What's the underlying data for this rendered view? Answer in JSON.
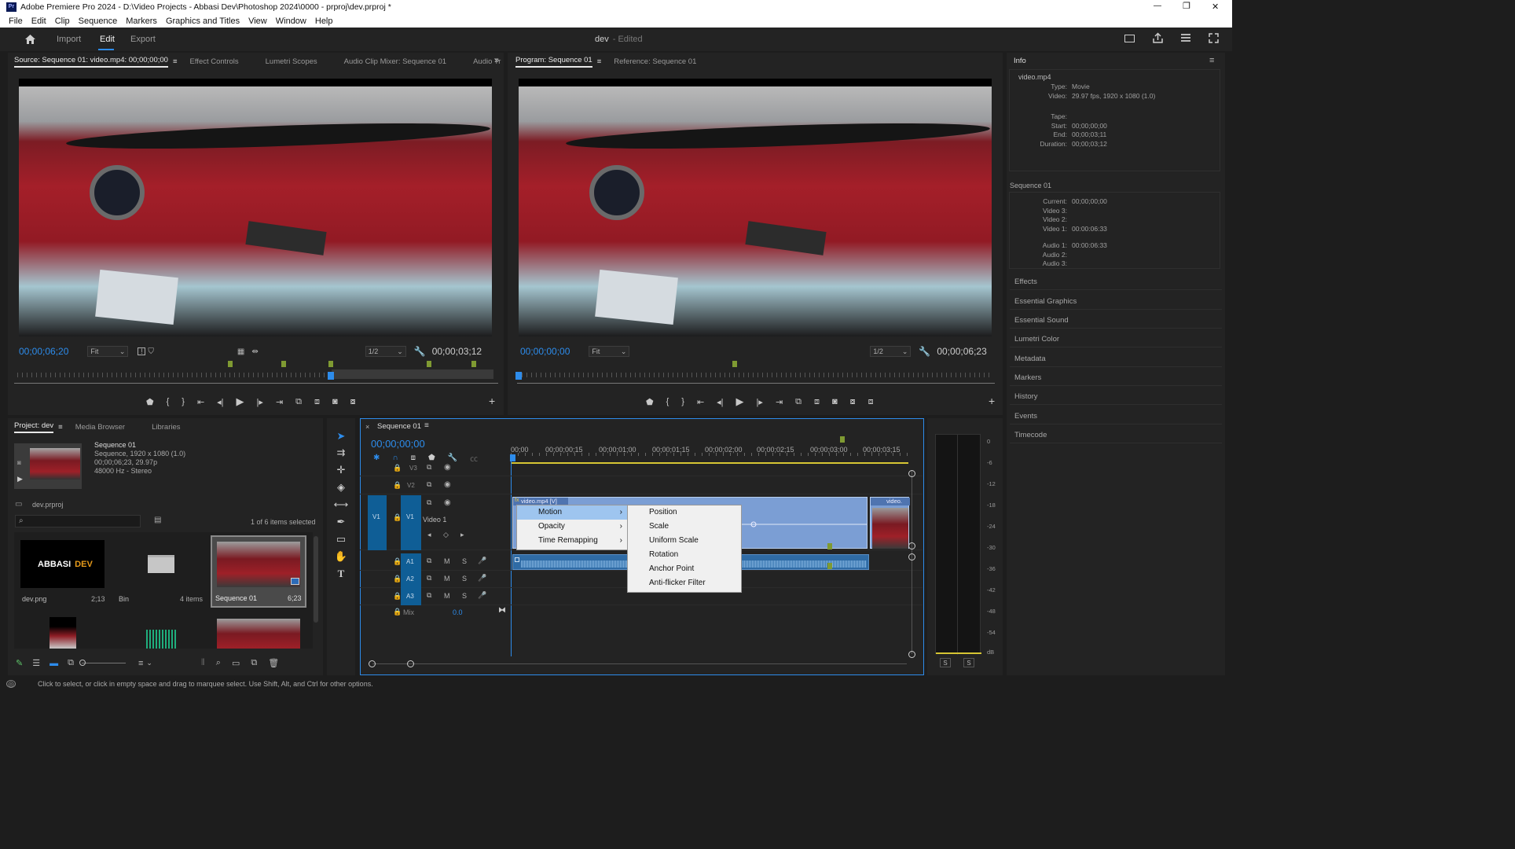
{
  "app": {
    "title": "Adobe Premiere Pro 2024 - D:\\Video Projects - Abbasi Dev\\Photoshop 2024\\0000 - prproj\\dev.prproj *",
    "logo": "Pr"
  },
  "window_buttons": {
    "minimize": "—",
    "maximize": "❐",
    "close": "✕"
  },
  "menu": [
    "File",
    "Edit",
    "Clip",
    "Sequence",
    "Markers",
    "Graphics and Titles",
    "View",
    "Window",
    "Help"
  ],
  "workspace": {
    "tabs": [
      "Import",
      "Edit",
      "Export"
    ],
    "active": "Edit",
    "project": "dev",
    "edited": "- Edited"
  },
  "source": {
    "tabs": [
      "Source: Sequence 01: video.mp4: 00;00;00;00",
      "Effect Controls",
      "Lumetri Scopes",
      "Audio Clip Mixer: Sequence 01",
      "Audio Tr"
    ],
    "timecode": "00;00;06;20",
    "fit": "Fit",
    "res": "1/2",
    "duration": "00;00;03;12",
    "overflow": "»"
  },
  "program": {
    "tabs": [
      "Program: Sequence 01",
      "Reference: Sequence 01"
    ],
    "timecode": "00;00;00;00",
    "fit": "Fit",
    "res": "1/2",
    "duration": "00;00;06;23"
  },
  "info": {
    "title": "Info",
    "clip_name": "video.mp4",
    "clip": [
      {
        "k": "Type:",
        "v": "Movie"
      },
      {
        "k": "Video:",
        "v": "29.97 fps, 1920 x 1080 (1.0)"
      }
    ],
    "tape": [
      {
        "k": "Tape:",
        "v": ""
      },
      {
        "k": "Start:",
        "v": "00;00;00;00"
      },
      {
        "k": "End:",
        "v": "00;00;03;11"
      },
      {
        "k": "Duration:",
        "v": "00;00;03;12"
      }
    ],
    "sequence_label": "Sequence 01",
    "seq": [
      {
        "k": "Current:",
        "v": "00;00;00;00"
      },
      {
        "k": "Video 3:",
        "v": ""
      },
      {
        "k": "Video 2:",
        "v": ""
      },
      {
        "k": "Video 1:",
        "v": "00:00:06:33"
      }
    ],
    "audio": [
      {
        "k": "Audio 1:",
        "v": "00:00:06:33"
      },
      {
        "k": "Audio 2:",
        "v": ""
      },
      {
        "k": "Audio 3:",
        "v": ""
      }
    ]
  },
  "right_sections": [
    "Effects",
    "Essential Graphics",
    "Essential Sound",
    "Lumetri Color",
    "Metadata",
    "Markers",
    "History",
    "Events",
    "Timecode"
  ],
  "project": {
    "tabs": [
      "Project: dev",
      "Media Browser",
      "Libraries"
    ],
    "seq_name": "Sequence 01",
    "seq_details": [
      "Sequence, 1920 x 1080 (1.0)",
      "00;00;06;23, 29.97p",
      "48000 Hz - Stereo"
    ],
    "file": "dev.prproj",
    "selected": "1 of 6 items selected",
    "items": [
      {
        "name": "dev.png",
        "meta": "2;13",
        "thumb": "ABBASI"
      },
      {
        "name": "Bin",
        "meta": "4 items"
      },
      {
        "name": "Sequence 01",
        "meta": "6;23"
      }
    ],
    "logo_word1": "ABBASI",
    "logo_word2": "DEV"
  },
  "timeline": {
    "tab": "Sequence 01",
    "timecode": "00;00;00;00",
    "ruler": [
      "00;00",
      "00;00;00;15",
      "00;00;01;00",
      "00;00;01;15",
      "00;00;02;00",
      "00;00;02;15",
      "00;00;03;00",
      "00;00;03;15"
    ],
    "video_tracks": [
      "V3",
      "V2",
      "V1"
    ],
    "video1_name": "Video 1",
    "audio_tracks": [
      "A1",
      "A2",
      "A3"
    ],
    "mix_label": "Mix",
    "mix_value": "0.0",
    "clip_label": "video.mp4 [V]",
    "clip2_label": "video.",
    "track_btns": {
      "mute": "M",
      "solo": "S"
    }
  },
  "context_menu": {
    "main": [
      {
        "label": "Motion",
        "sub": true
      },
      {
        "label": "Opacity",
        "sub": true
      },
      {
        "label": "Time Remapping",
        "sub": true
      }
    ],
    "sub": [
      "Position",
      "Scale",
      "Uniform Scale",
      "Rotation",
      "Anchor Point",
      "Anti-flicker Filter"
    ]
  },
  "meter": {
    "labels": [
      "0",
      "-6",
      "-12",
      "-18",
      "-24",
      "-30",
      "-36",
      "-42",
      "-48",
      "-54",
      "dB"
    ],
    "solo": [
      "S",
      "S"
    ]
  },
  "status": "Click to select, or click in empty space and drag to marquee select. Use Shift, Alt, and Ctrl for other options.",
  "colors": {
    "accent": "#2d8ceb",
    "clip_video": "#7b9ed4",
    "clip_audio": "#2f6ba5",
    "track_blue": "#0f5e96",
    "playhead": "#2d8ceb"
  }
}
